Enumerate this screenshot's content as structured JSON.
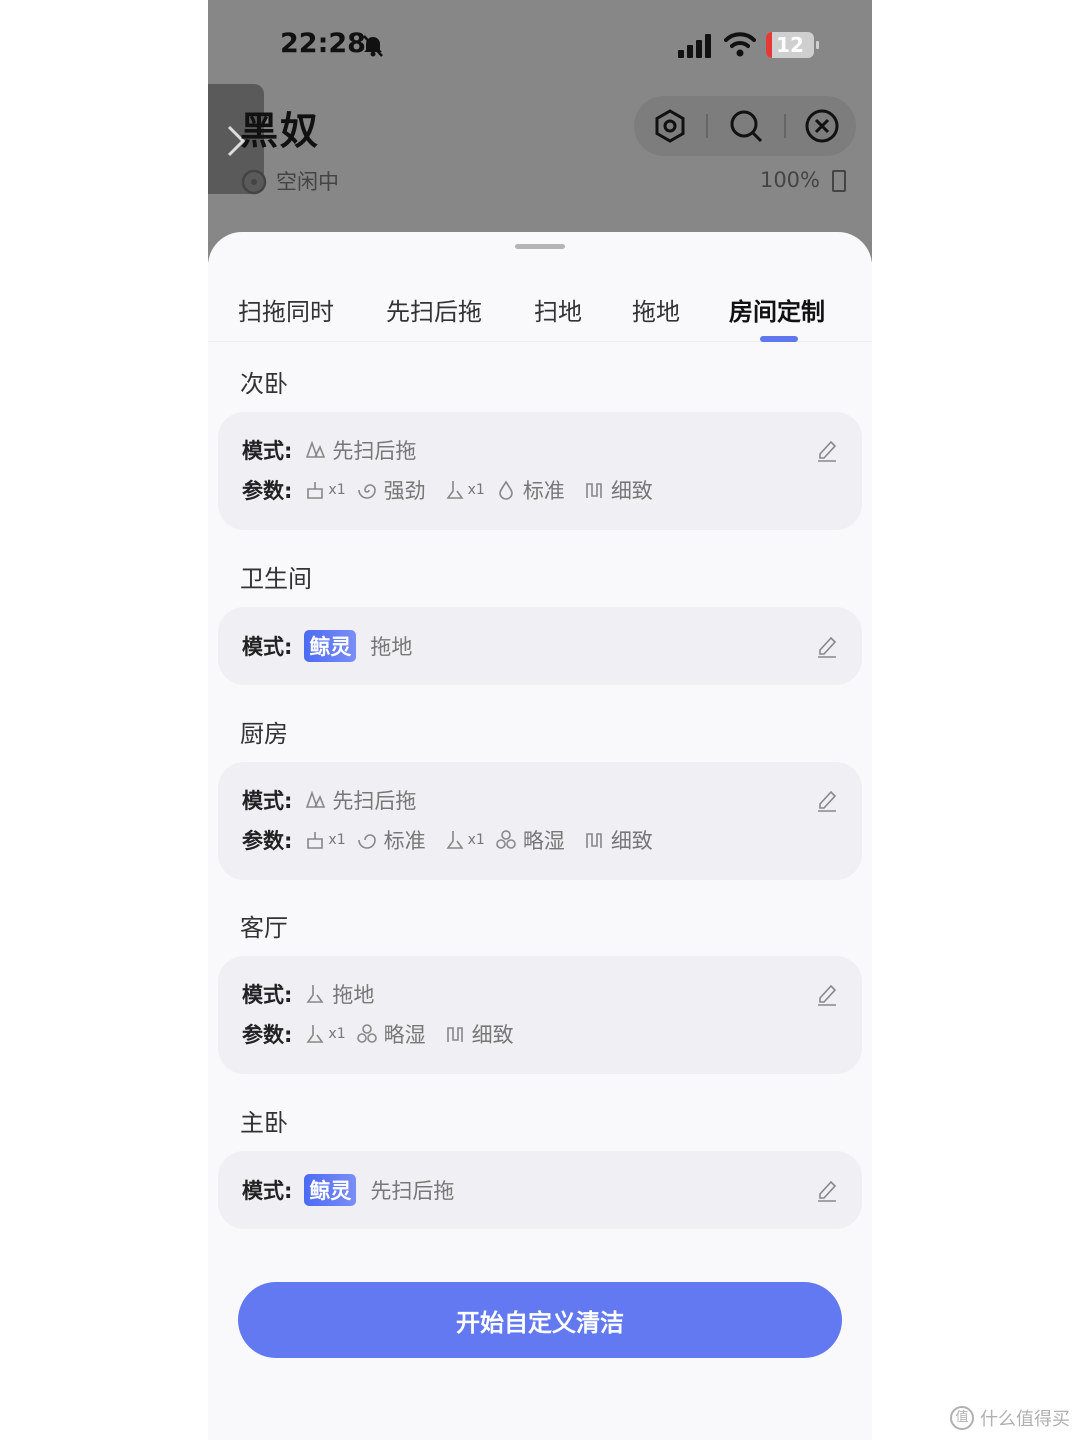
{
  "status_bar": {
    "time": "22:28",
    "battery_level": "12",
    "icons": [
      "bell-off-icon",
      "signal-icon",
      "wifi-icon",
      "battery-icon"
    ]
  },
  "header": {
    "device_name": "黑奴",
    "status": "空闲中",
    "battery": "100%",
    "actions": [
      "settings-icon",
      "search-icon",
      "close-icon"
    ]
  },
  "tabs": [
    {
      "label": "扫拖同时",
      "active": false
    },
    {
      "label": "先扫后拖",
      "active": false
    },
    {
      "label": "扫地",
      "active": false
    },
    {
      "label": "拖地",
      "active": false
    },
    {
      "label": "房间定制",
      "active": true
    }
  ],
  "labels": {
    "mode": "模式:",
    "params": "参数:",
    "whale_badge": "鲸灵"
  },
  "rooms": [
    {
      "name": "次卧",
      "mode": "先扫后拖",
      "params": [
        {
          "icon": "sweep-icon",
          "text": "x1"
        },
        {
          "icon": "suction-icon",
          "text": "强劲"
        },
        {
          "icon": "mop-icon",
          "text": "x1"
        },
        {
          "icon": "water-icon",
          "text": "标准"
        },
        {
          "icon": "route-icon",
          "text": "细致"
        }
      ]
    },
    {
      "name": "卫生间",
      "mode": "拖地"
    },
    {
      "name": "厨房",
      "mode": "先扫后拖",
      "params": [
        {
          "icon": "sweep-icon",
          "text": "x1"
        },
        {
          "icon": "suction-icon",
          "text": "标准"
        },
        {
          "icon": "mop-icon",
          "text": "x1"
        },
        {
          "icon": "water-icon",
          "text": "略湿"
        },
        {
          "icon": "route-icon",
          "text": "细致"
        }
      ]
    },
    {
      "name": "客厅",
      "mode": "拖地",
      "params": [
        {
          "icon": "mop-icon",
          "text": "x1"
        },
        {
          "icon": "water-icon",
          "text": "略湿"
        },
        {
          "icon": "route-icon",
          "text": "细致"
        }
      ]
    },
    {
      "name": "主卧",
      "mode": "先扫后拖"
    }
  ],
  "start_button": "开始自定义清洁",
  "watermark": "什么值得买",
  "colors": {
    "accent": "#6279f1",
    "card_bg": "#f0f0f4",
    "overlay": "#878787"
  }
}
